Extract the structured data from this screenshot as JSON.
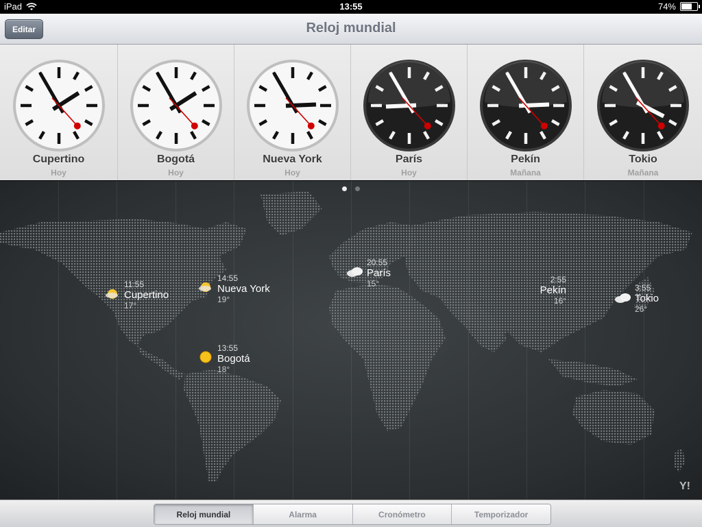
{
  "status_bar": {
    "carrier": "iPad",
    "time": "13:55",
    "battery": "74%",
    "battery_level": 0.74
  },
  "nav": {
    "title": "Reloj mundial",
    "edit_label": "Editar"
  },
  "clocks": [
    {
      "city": "Cupertino",
      "day": "Hoy",
      "time": "13:55",
      "hour": 13,
      "minute": 55,
      "second": 23,
      "face": "light"
    },
    {
      "city": "Bogotá",
      "day": "Hoy",
      "time": "13:55",
      "hour": 13,
      "minute": 55,
      "second": 23,
      "face": "light"
    },
    {
      "city": "Nueva York",
      "day": "Hoy",
      "time": "13:55",
      "hour": 14,
      "minute": 55,
      "second": 23,
      "face": "light"
    },
    {
      "city": "París",
      "day": "Hoy",
      "time": "20:55",
      "hour": 20,
      "minute": 55,
      "second": 23,
      "face": "dark"
    },
    {
      "city": "Pekín",
      "day": "Mañana",
      "time": "2:55",
      "hour": 2,
      "minute": 55,
      "second": 23,
      "face": "dark"
    },
    {
      "city": "Tokio",
      "day": "Mañana",
      "time": "3:55",
      "hour": 3,
      "minute": 55,
      "second": 23,
      "face": "dark"
    }
  ],
  "pager": {
    "pages": 2,
    "current": 1
  },
  "map_markers": [
    {
      "id": "cupertino",
      "time": "11:55",
      "city": "Cupertino",
      "temp": "17°",
      "icon": "partly-sunny-icon"
    },
    {
      "id": "nueva-york",
      "time": "14:55",
      "city": "Nueva York",
      "temp": "19°",
      "icon": "partly-sunny-icon"
    },
    {
      "id": "bogota",
      "time": "13:55",
      "city": "Bogotá",
      "temp": "18°",
      "icon": "sun-icon"
    },
    {
      "id": "paris",
      "time": "20:55",
      "city": "París",
      "temp": "15°",
      "icon": "cloud-icon"
    },
    {
      "id": "pekin",
      "time": "2:55",
      "city": "Pekín",
      "temp": "16°",
      "icon": "none"
    },
    {
      "id": "tokio",
      "time": "3:55",
      "city": "Tokio",
      "temp": "26°",
      "icon": "cloud-icon"
    }
  ],
  "yahoo_logo": "Y!",
  "tabs": [
    {
      "label": "Reloj mundial",
      "selected": true
    },
    {
      "label": "Alarma",
      "selected": false
    },
    {
      "label": "Cronómetro",
      "selected": false
    },
    {
      "label": "Temporizador",
      "selected": false
    }
  ]
}
